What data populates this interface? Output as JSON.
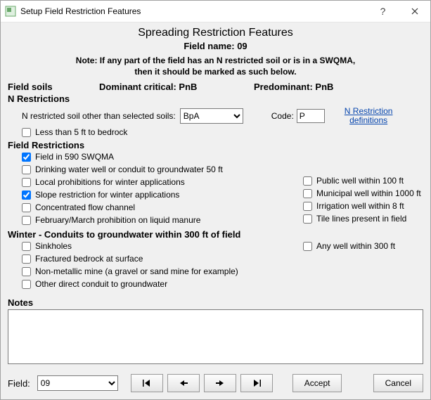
{
  "window": {
    "title": "Setup Field Restriction Features"
  },
  "headings": {
    "main": "Spreading Restriction Features",
    "field_name_label": "Field name:",
    "field_name_value": "09",
    "note_line1": "Note: If any part of the field has an N restricted soil or is in a SWQMA,",
    "note_line2": "then it should be marked as such below."
  },
  "soils": {
    "field_soils": "Field soils",
    "dominant_label": "Dominant critical:",
    "dominant_value": "PnB",
    "predominant_label": "Predominant:",
    "predominant_value": "PnB"
  },
  "n_restrictions": {
    "header": "N Restrictions",
    "soil_label": "N restricted soil other than selected soils:",
    "soil_value": "BpA",
    "code_label": "Code:",
    "code_value": "P",
    "def_link_line1": "N Restriction",
    "def_link_line2": "definitions",
    "less5ft": "Less than 5 ft to bedrock"
  },
  "field_restrictions": {
    "header": "Field Restrictions",
    "left": [
      {
        "label": "Field in 590 SWQMA",
        "checked": true
      },
      {
        "label": "Drinking water well or conduit to groundwater 50 ft",
        "checked": false
      },
      {
        "label": "Local prohibitions for winter applications",
        "checked": false
      },
      {
        "label": "Slope restriction for winter applications",
        "checked": true
      },
      {
        "label": "Concentrated flow channel",
        "checked": false
      },
      {
        "label": "February/March prohibition on liquid manure",
        "checked": false
      }
    ],
    "right": [
      {
        "label": "Public well within 100 ft",
        "checked": false
      },
      {
        "label": "Municipal well within 1000 ft",
        "checked": false
      },
      {
        "label": "Irrigation well within 8 ft",
        "checked": false
      },
      {
        "label": "Tile lines present in field",
        "checked": false
      }
    ]
  },
  "winter": {
    "header": "Winter - Conduits to groundwater within 300 ft of field",
    "left": [
      {
        "label": "Sinkholes",
        "checked": false
      },
      {
        "label": "Fractured bedrock at surface",
        "checked": false
      },
      {
        "label": "Non-metallic mine (a gravel or sand mine for example)",
        "checked": false
      },
      {
        "label": "Other direct conduit to groundwater",
        "checked": false
      }
    ],
    "right": [
      {
        "label": "Any well within 300 ft",
        "checked": false
      }
    ]
  },
  "notes": {
    "header": "Notes",
    "value": ""
  },
  "footer": {
    "field_label": "Field:",
    "field_value": "09",
    "accept": "Accept",
    "cancel": "Cancel"
  }
}
